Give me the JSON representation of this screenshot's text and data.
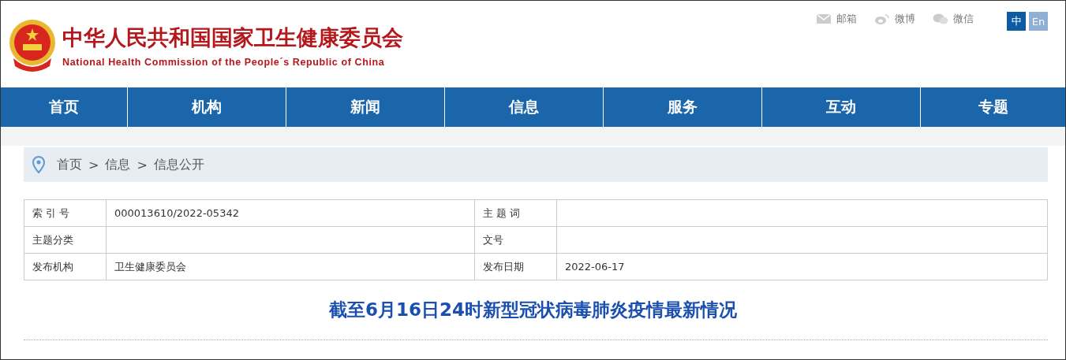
{
  "header": {
    "title": "中华人民共和国国家卫生健康委员会",
    "subtitle": "National Health Commission of the People´s Republic of China",
    "links": [
      {
        "kind": "mail",
        "label": "邮箱"
      },
      {
        "kind": "weibo",
        "label": "微博"
      },
      {
        "kind": "wechat",
        "label": "微信"
      }
    ],
    "languages": [
      {
        "label": "中",
        "selected": true
      },
      {
        "label": "En",
        "selected": false
      }
    ]
  },
  "nav": [
    "首页",
    "机构",
    "新闻",
    "信息",
    "服务",
    "互动",
    "专题"
  ],
  "breadcrumb": {
    "items": [
      "首页",
      "信息",
      "信息公开"
    ],
    "separator": ">"
  },
  "meta_table": {
    "rows": [
      [
        "索 引 号",
        "000013610/2022-05342",
        "主 题 词",
        ""
      ],
      [
        "主题分类",
        "",
        "文号",
        ""
      ],
      [
        "发布机构",
        "卫生健康委员会",
        "发布日期",
        "2022-06-17"
      ]
    ]
  },
  "article": {
    "title": "截至6月16日24时新型冠状病毒肺炎疫情最新情况"
  }
}
